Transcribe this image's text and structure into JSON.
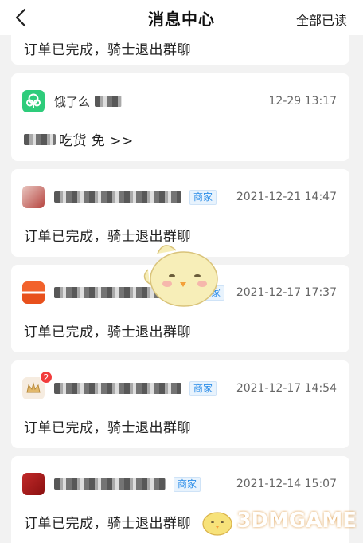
{
  "header": {
    "title": "消息中心",
    "mark_all_read": "全部已读"
  },
  "messages": [
    {
      "message": "订单已完成，骑士退出群聊"
    },
    {
      "name": "饿了么",
      "time": "12-29 13:17",
      "message": "吃货 免 >>",
      "avatar_color": "#2ecc7b"
    },
    {
      "tag": "商家",
      "time": "2021-12-21 14:47",
      "message": "订单已完成，骑士退出群聊"
    },
    {
      "tag": "商家",
      "time": "2021-12-17 17:37",
      "message": "订单已完成，骑士退出群聊"
    },
    {
      "tag": "商家",
      "time": "2021-12-17 14:54",
      "message": "订单已完成，骑士退出群聊",
      "badge": "2"
    },
    {
      "tag": "商家",
      "time": "2021-12-14 15:07",
      "message": "订单已完成，骑士退出群聊"
    }
  ],
  "watermark": "3DMGAME",
  "colors": {
    "tag_text": "#2b8de8",
    "badge": "#f23c3c",
    "accent_green": "#2ecc7b"
  }
}
